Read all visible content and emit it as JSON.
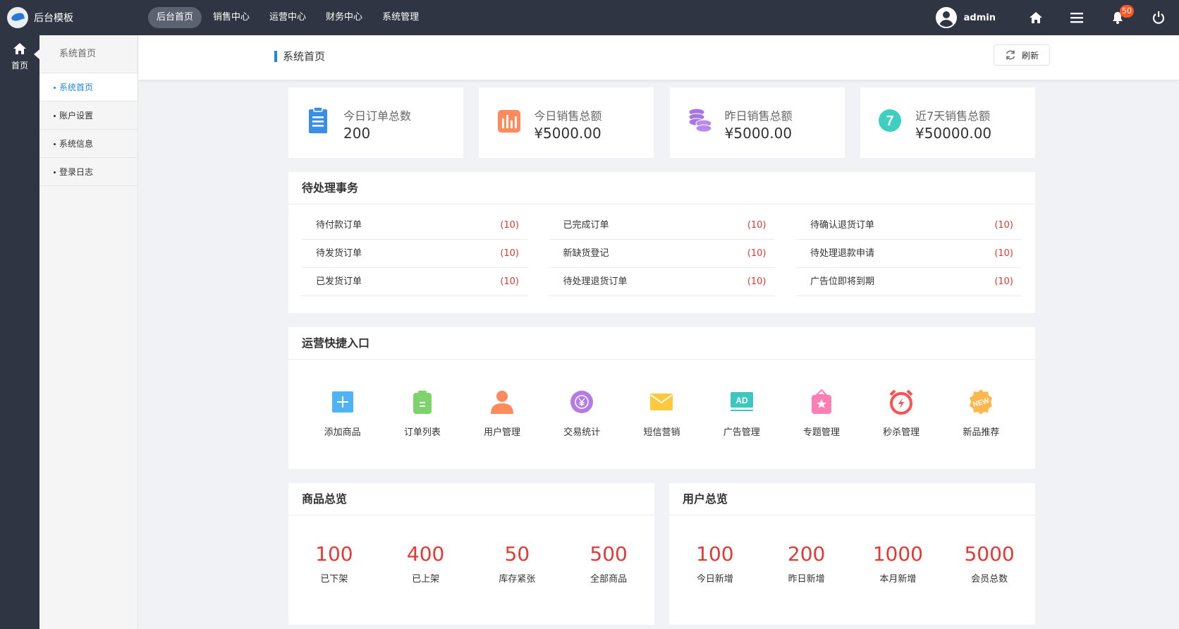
{
  "app": {
    "name": "后台模板"
  },
  "topnav": [
    {
      "label": "后台首页",
      "active": true
    },
    {
      "label": "销售中心"
    },
    {
      "label": "运营中心"
    },
    {
      "label": "财务中心"
    },
    {
      "label": "系统管理"
    }
  ],
  "user": {
    "name": "admin",
    "notifications": "50"
  },
  "rail": {
    "home_label": "首页"
  },
  "sidebar": {
    "title": "系统首页",
    "items": [
      {
        "label": "系统首页",
        "active": true
      },
      {
        "label": "账户设置"
      },
      {
        "label": "系统信息"
      },
      {
        "label": "登录日志"
      }
    ]
  },
  "header": {
    "title": "系统首页",
    "refresh_label": "刷新"
  },
  "stats": [
    {
      "label": "今日订单总数",
      "value": "200",
      "color": "#3a8ee6",
      "icon": "clipboard-icon"
    },
    {
      "label": "今日销售总额",
      "value": "¥5000.00",
      "color": "#ff8a5c",
      "icon": "bar-chart-icon"
    },
    {
      "label": "昨日销售总额",
      "value": "¥5000.00",
      "color": "#a776e0",
      "icon": "coins-icon"
    },
    {
      "label": "近7天销售总额",
      "value": "¥50000.00",
      "color": "#3ecfc0",
      "icon": "seven-badge-icon",
      "badge_text": "7"
    }
  ],
  "todo": {
    "title": "待处理事务",
    "columns": [
      [
        {
          "label": "待付款订单",
          "count": "(10)"
        },
        {
          "label": "待发货订单",
          "count": "(10)"
        },
        {
          "label": "已发货订单",
          "count": "(10)"
        }
      ],
      [
        {
          "label": "已完成订单",
          "count": "(10)"
        },
        {
          "label": "新缺货登记",
          "count": "(10)"
        },
        {
          "label": "待处理退货订单",
          "count": "(10)"
        }
      ],
      [
        {
          "label": "待确认退货订单",
          "count": "(10)"
        },
        {
          "label": "待处理退款申请",
          "count": "(10)"
        },
        {
          "label": "广告位即将到期",
          "count": "(10)"
        }
      ]
    ]
  },
  "quick": {
    "title": "运营快捷入口",
    "items": [
      {
        "label": "添加商品",
        "icon": "add-product-icon",
        "color": "#4fb3f6"
      },
      {
        "label": "订单列表",
        "icon": "order-list-icon",
        "color": "#7ed36c"
      },
      {
        "label": "用户管理",
        "icon": "user-icon",
        "color": "#ff8a5c"
      },
      {
        "label": "交易统计",
        "icon": "yen-coin-icon",
        "color": "#b27be6"
      },
      {
        "label": "短信营销",
        "icon": "envelope-icon",
        "color": "#ffc83d"
      },
      {
        "label": "广告管理",
        "icon": "ad-icon",
        "color": "#3ec7c0",
        "badge_text": "AD"
      },
      {
        "label": "专题管理",
        "icon": "topic-bag-icon",
        "color": "#ff7eb3"
      },
      {
        "label": "秒杀管理",
        "icon": "alarm-clock-icon",
        "color": "#ff5050"
      },
      {
        "label": "新品推荐",
        "icon": "new-badge-icon",
        "color": "#ffb74d",
        "badge_text": "NEW"
      }
    ]
  },
  "products": {
    "title": "商品总览",
    "items": [
      {
        "value": "100",
        "label": "已下架"
      },
      {
        "value": "400",
        "label": "已上架"
      },
      {
        "value": "50",
        "label": "库存紧张"
      },
      {
        "value": "500",
        "label": "全部商品"
      }
    ]
  },
  "users": {
    "title": "用户总览",
    "items": [
      {
        "value": "100",
        "label": "今日新增"
      },
      {
        "value": "200",
        "label": "昨日新增"
      },
      {
        "value": "1000",
        "label": "本月新增"
      },
      {
        "value": "5000",
        "label": "会员总数"
      }
    ]
  }
}
